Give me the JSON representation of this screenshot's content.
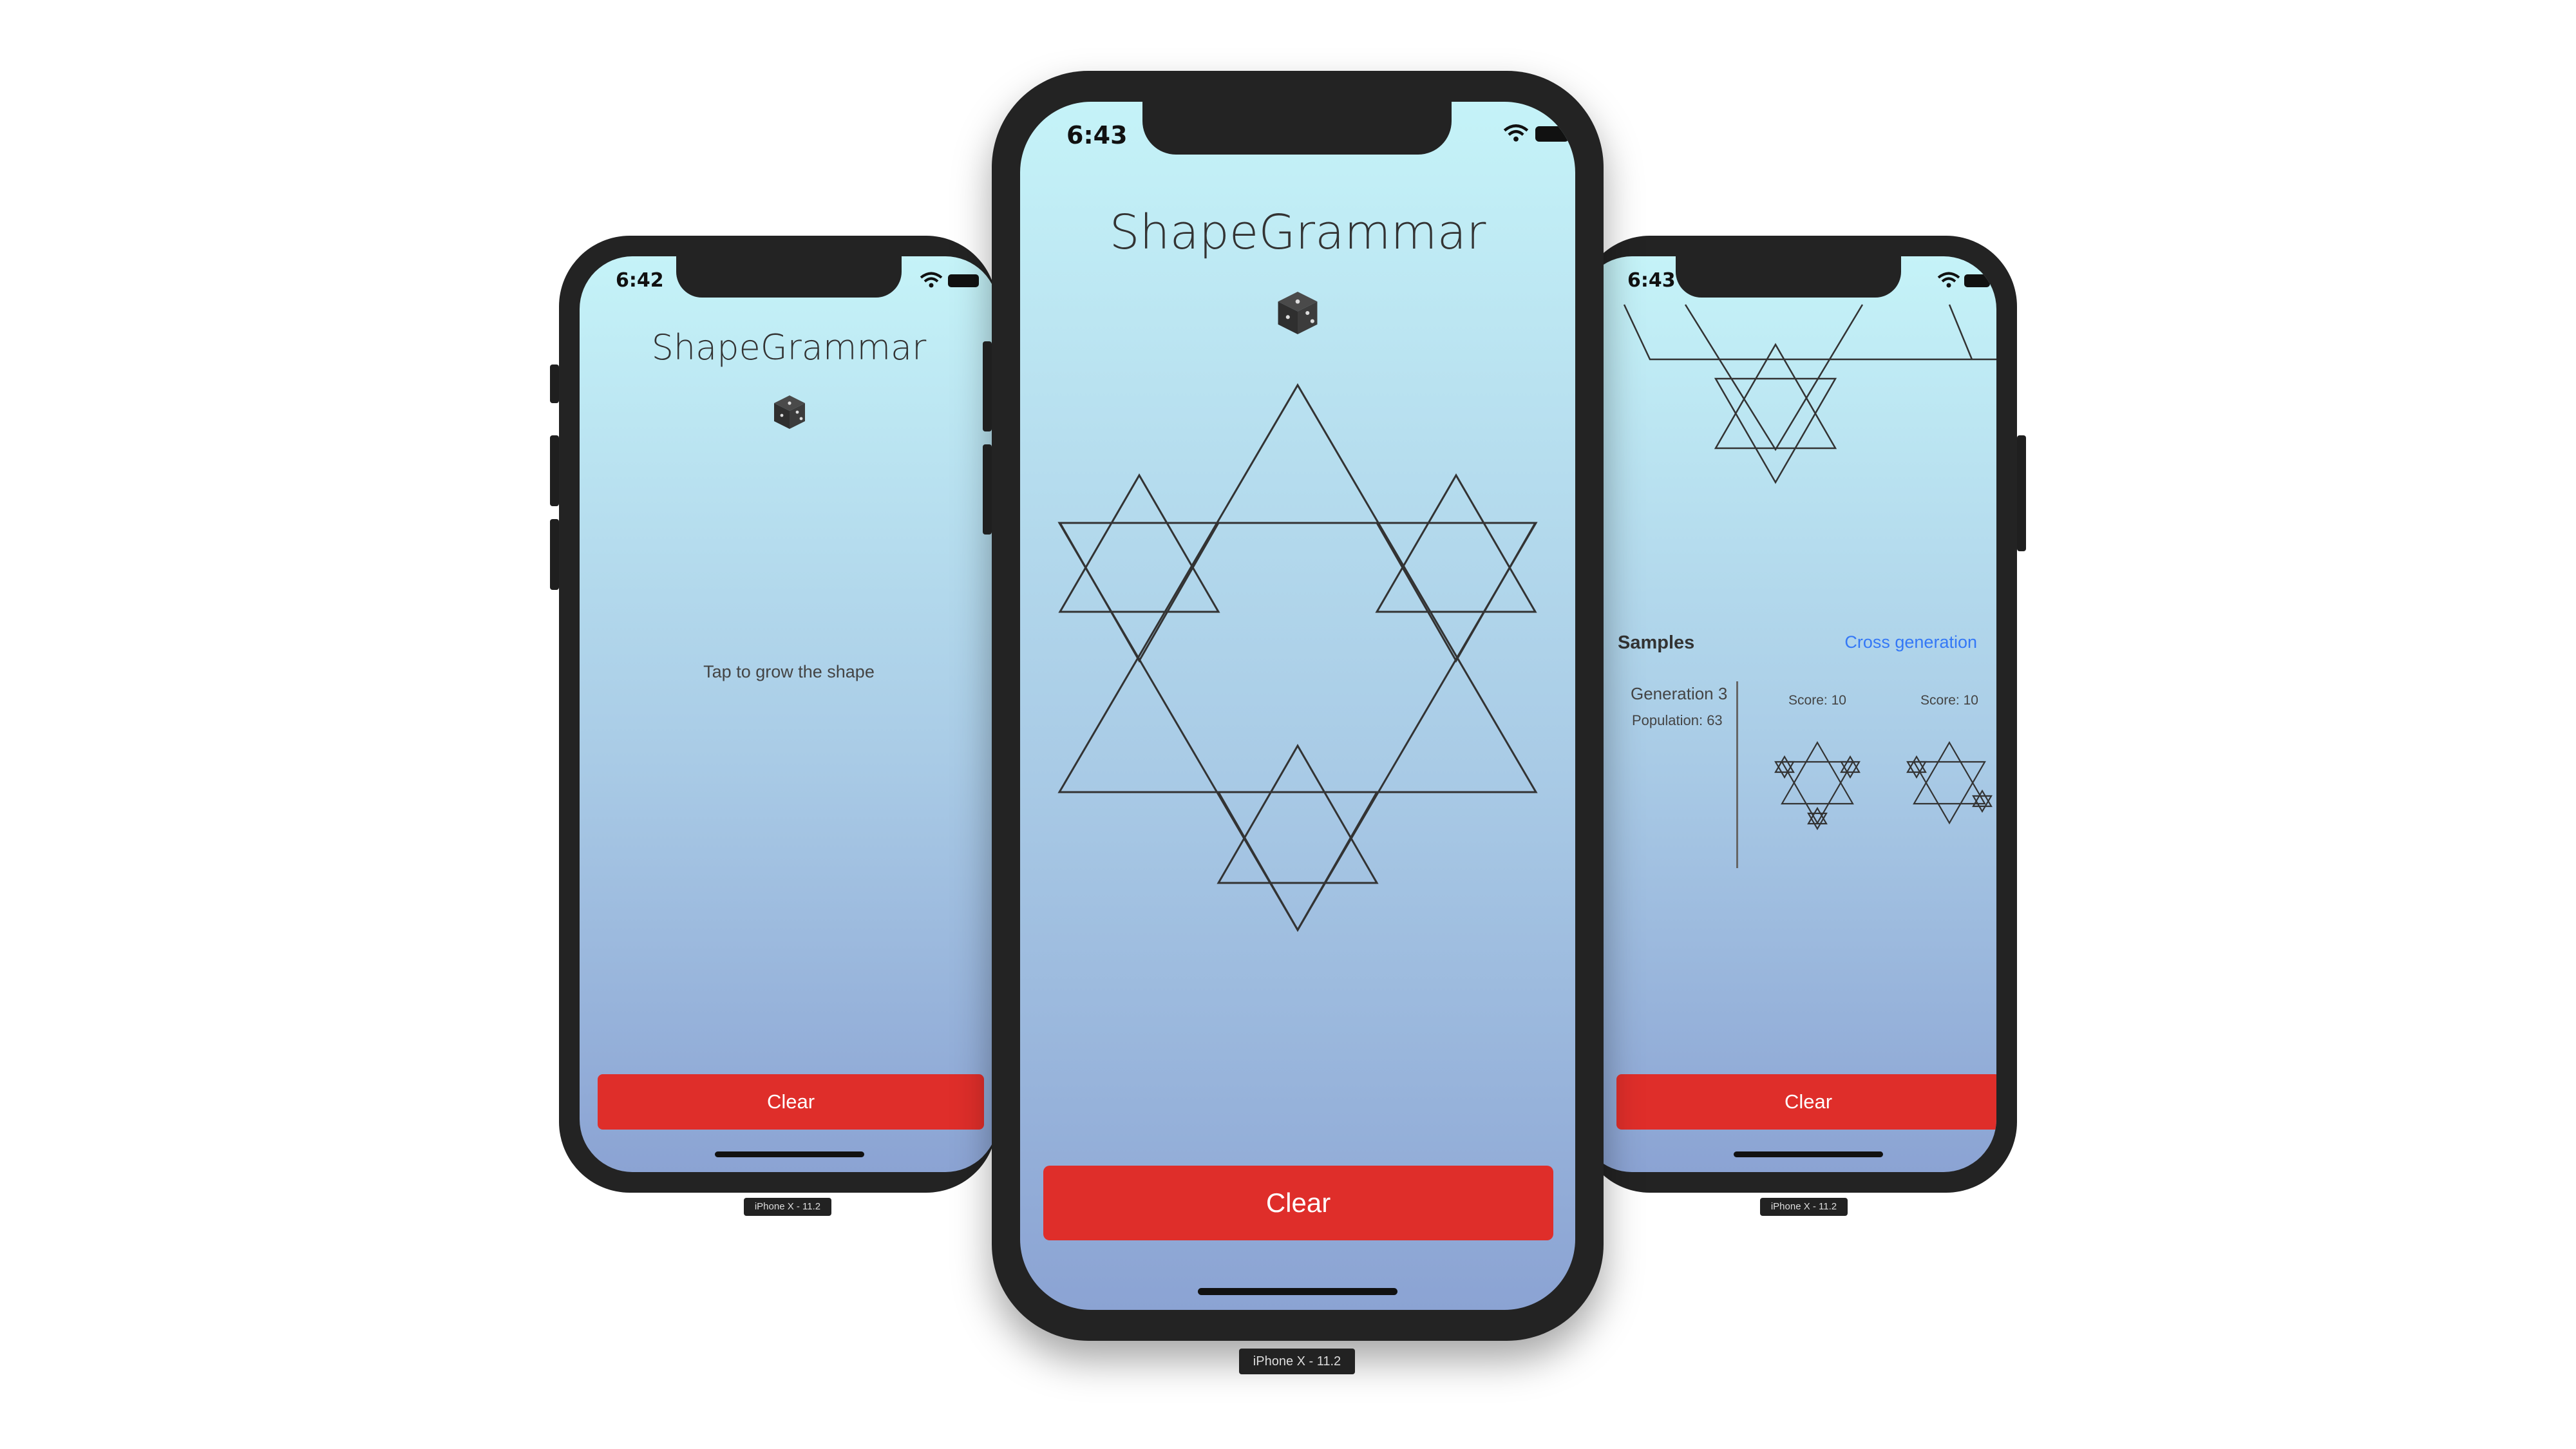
{
  "left_phone": {
    "time": "6:42",
    "app_title": "ShapeGrammar",
    "dice_icon": "dice-icon",
    "hint": "Tap to grow the shape",
    "clear_label": "Clear",
    "device_label": "iPhone X - 11.2"
  },
  "center_phone": {
    "time": "6:43",
    "app_title": "ShapeGrammar",
    "dice_icon": "dice-icon",
    "clear_label": "Clear",
    "device_label": "iPhone X - 11.2"
  },
  "right_phone": {
    "time": "6:43",
    "samples_heading": "Samples",
    "cross_generation_label": "Cross generation",
    "generation_label": "Generation 3",
    "population_label": "Population: 63",
    "samples": [
      {
        "score_label": "Score: 10"
      },
      {
        "score_label": "Score: 10"
      }
    ],
    "clear_label": "Clear",
    "device_label": "iPhone X - 11.2"
  },
  "colors": {
    "clear_button": "#df2e2a",
    "link": "#3478f6",
    "gradient_top": "#c5f3f8",
    "gradient_bottom": "#8ba3d3"
  }
}
